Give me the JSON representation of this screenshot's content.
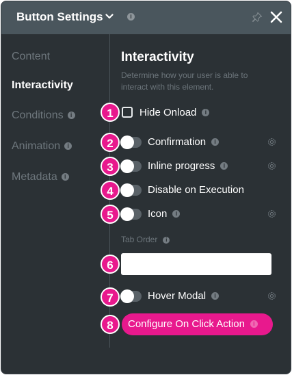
{
  "header": {
    "title": "Button Settings",
    "info_icon": "info-icon",
    "pin_icon": "pin-icon",
    "close_icon": "close-icon"
  },
  "sidebar": {
    "items": [
      {
        "label": "Content",
        "active": false,
        "has_info": false
      },
      {
        "label": "Interactivity",
        "active": true,
        "has_info": false
      },
      {
        "label": "Conditions",
        "active": false,
        "has_info": true
      },
      {
        "label": "Animation",
        "active": false,
        "has_info": true
      },
      {
        "label": "Metadata",
        "active": false,
        "has_info": true
      }
    ]
  },
  "main": {
    "title": "Interactivity",
    "description": "Determine how your user is able to interact with this element.",
    "hide_onload": {
      "badge": "1",
      "label": "Hide Onload",
      "checked": false
    },
    "confirmation": {
      "badge": "2",
      "label": "Confirmation",
      "on": false
    },
    "inline_progress": {
      "badge": "3",
      "label": "Inline progress",
      "on": false
    },
    "disable_on_execution": {
      "badge": "4",
      "label": "Disable on Execution",
      "on": false
    },
    "icon": {
      "badge": "5",
      "label": "Icon",
      "on": false
    },
    "tab_order": {
      "badge": "6",
      "label": "Tab Order",
      "value": ""
    },
    "hover_modal": {
      "badge": "7",
      "label": "Hover Modal",
      "on": false
    },
    "configure_action": {
      "badge": "8",
      "label": "Configure On Click Action"
    }
  },
  "colors": {
    "panel_bg": "#2b3135",
    "header_bg": "#4a565d",
    "accent": "#e8198d",
    "muted_text": "#6e777d"
  }
}
